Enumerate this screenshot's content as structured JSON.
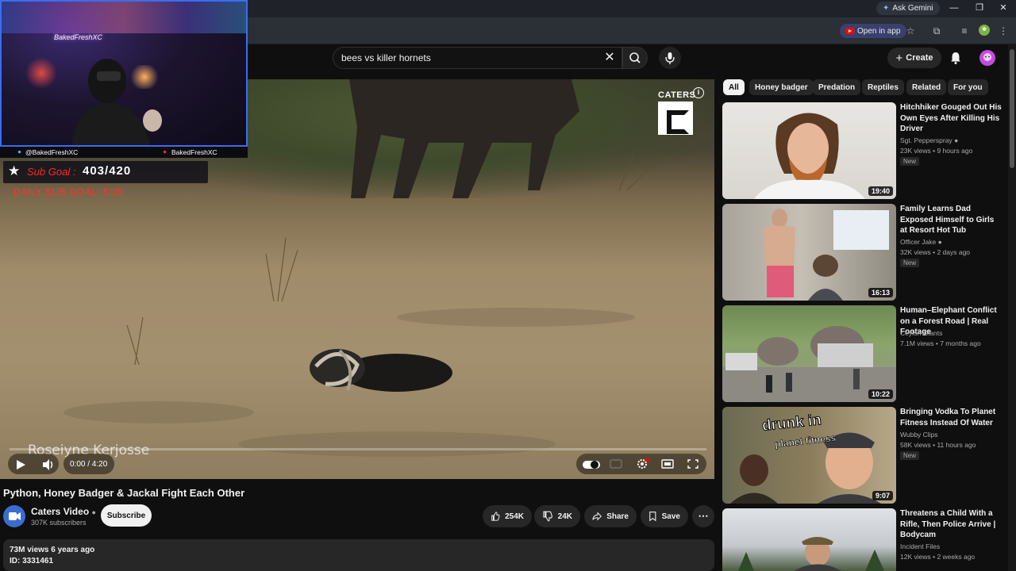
{
  "browser": {
    "gemini_label": "Ask Gemini",
    "open_in_app": "Open in app"
  },
  "search": {
    "query": "bees vs killer hornets"
  },
  "masthead": {
    "create_label": "Create"
  },
  "stream_overlay": {
    "handle_left": "@BakedFreshXC",
    "handle_right": "BakedFreshXC",
    "sub_goal_label": "Sub Goal :",
    "sub_goal_value": "403/420",
    "daily_goal": "DAILY SUB GOAL: 6/20",
    "neon_sign": "BakedFreshXC"
  },
  "player": {
    "brand": "CATERS",
    "watermark": "Roseiyne Kerjosse",
    "time": "0:00 / 4:20",
    "progress": 0
  },
  "video": {
    "title": "Python, Honey Badger & Jackal Fight Each Other",
    "channel": "Caters Video",
    "subscribers": "307K subscribers",
    "subscribe_label": "Subscribe",
    "likes": "254K",
    "dislikes": "24K",
    "share_label": "Share",
    "save_label": "Save",
    "views_line": "73M views  6 years ago",
    "id_line": "ID: 3331461"
  },
  "chips": [
    "All",
    "Honey badger",
    "Predation",
    "Reptiles",
    "Related",
    "For you"
  ],
  "recommendations": [
    {
      "title": "Hitchhiker Gouged Out His Own Eyes After Killing His Driver",
      "channel": "Sgt. Pepperspray",
      "verified": true,
      "meta": "23K views • 9 hours ago",
      "badge": "New",
      "duration": "19:40"
    },
    {
      "title": "Family Learns Dad Exposed Himself to Girls at Resort Hot Tub",
      "channel": "Officer Jake",
      "verified": true,
      "meta": "32K views • 2 days ago",
      "badge": "New",
      "duration": "16:13"
    },
    {
      "title": "Human–Elephant Conflict on a Forest Road | Real Footage",
      "channel": "Ceylon Giants",
      "verified": false,
      "meta": "7.1M views • 7 months ago",
      "badge": "",
      "duration": "10:22"
    },
    {
      "title": "Bringing Vodka To Planet Fitness Instead Of Water",
      "channel": "Wubby Clips",
      "verified": false,
      "meta": "58K views • 11 hours ago",
      "badge": "New",
      "duration": "9:07",
      "thumb_text_1": "drunk in",
      "thumb_text_2": "planet fitness"
    },
    {
      "title": "Threatens a Child With a Rifle, Then Police Arrive | Bodycam",
      "channel": "Incident Files",
      "verified": false,
      "meta": "12K views • 2 weeks ago",
      "badge": "",
      "duration": ""
    }
  ],
  "colors": {
    "background": "#0f0f0f",
    "surface": "#272727",
    "accent_red": "#ff0000",
    "stream_border": "#3a6df0"
  }
}
